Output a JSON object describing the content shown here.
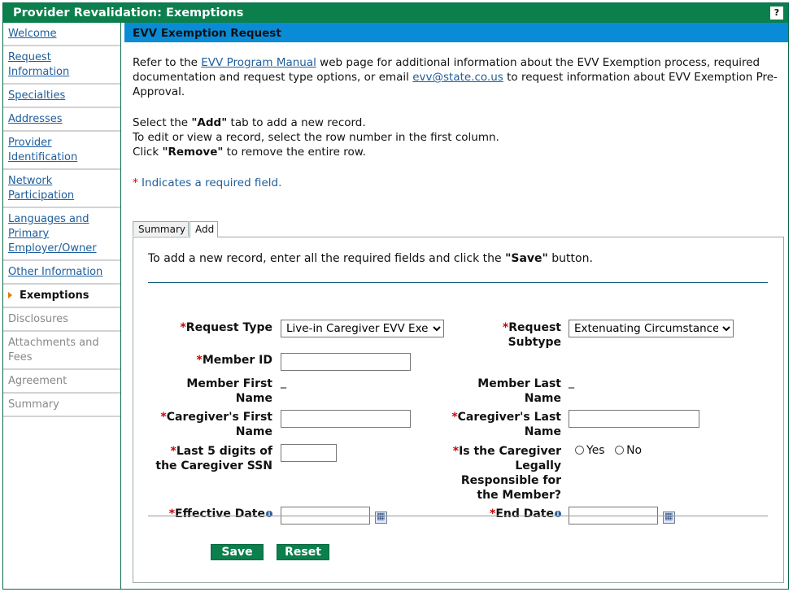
{
  "window": {
    "title": "Provider Revalidation: Exemptions",
    "help_label": "?"
  },
  "sidebar": {
    "items": [
      {
        "label": "Welcome",
        "state": "link"
      },
      {
        "label": "Request Information",
        "state": "link"
      },
      {
        "label": "Specialties",
        "state": "link"
      },
      {
        "label": "Addresses",
        "state": "link"
      },
      {
        "label": "Provider Identification",
        "state": "link"
      },
      {
        "label": "Network Participation",
        "state": "link"
      },
      {
        "label": "Languages and Primary Employer/Owner",
        "state": "link"
      },
      {
        "label": "Other Information",
        "state": "link"
      },
      {
        "label": "Exemptions",
        "state": "current"
      },
      {
        "label": "Disclosures",
        "state": "disabled"
      },
      {
        "label": "Attachments and Fees",
        "state": "disabled"
      },
      {
        "label": "Agreement",
        "state": "disabled"
      },
      {
        "label": "Summary",
        "state": "disabled"
      }
    ]
  },
  "main": {
    "section_title": "EVV Exemption Request",
    "intro": {
      "part1": "Refer to the ",
      "manual_link": "EVV Program Manual",
      "part2": " web page for additional information about the EVV Exemption process, required documentation and request type options, or email ",
      "email_link": "evv@state.co.us",
      "part3": " to request information about EVV Exemption Pre-Approval."
    },
    "instructions": {
      "line1_pre": "Select the ",
      "line1_bold": "\"Add\"",
      "line1_post": " tab to add a new record.",
      "line2": "To edit or view a record, select the row number in the first column.",
      "line3_pre": "Click ",
      "line3_bold": "\"Remove\"",
      "line3_post": " to remove the entire row."
    },
    "required_note": {
      "star": "*",
      "text": " Indicates a required field."
    },
    "tabs": [
      {
        "label": "Summary"
      },
      {
        "label": "Add"
      }
    ],
    "form": {
      "intro_pre": "To add a new record, enter all the required fields and click the ",
      "intro_bold": "\"Save\"",
      "intro_post": " button.",
      "request_type": {
        "label": "Request Type",
        "value": "Live-in Caregiver EVV Exemption"
      },
      "request_subtype": {
        "label": "Request Subtype",
        "value": "Extenuating Circumstances"
      },
      "member_id": {
        "label": "Member ID",
        "value": ""
      },
      "member_first_name": {
        "label": "Member First Name",
        "value": "_"
      },
      "member_last_name": {
        "label": "Member Last Name",
        "value": "_"
      },
      "caregiver_first_name": {
        "label": "Caregiver's First Name",
        "value": ""
      },
      "caregiver_last_name": {
        "label": "Caregiver's Last Name",
        "value": ""
      },
      "ssn_last5": {
        "label": "Last 5 digits of the Caregiver SSN",
        "value": ""
      },
      "legally_responsible": {
        "label": "Is the Caregiver Legally Responsible for the Member?",
        "options": [
          "Yes",
          "No"
        ]
      },
      "effective_date": {
        "label": "Effective Date",
        "value": ""
      },
      "end_date": {
        "label": "End Date",
        "value": ""
      },
      "save_label": "Save",
      "reset_label": "Reset"
    }
  }
}
